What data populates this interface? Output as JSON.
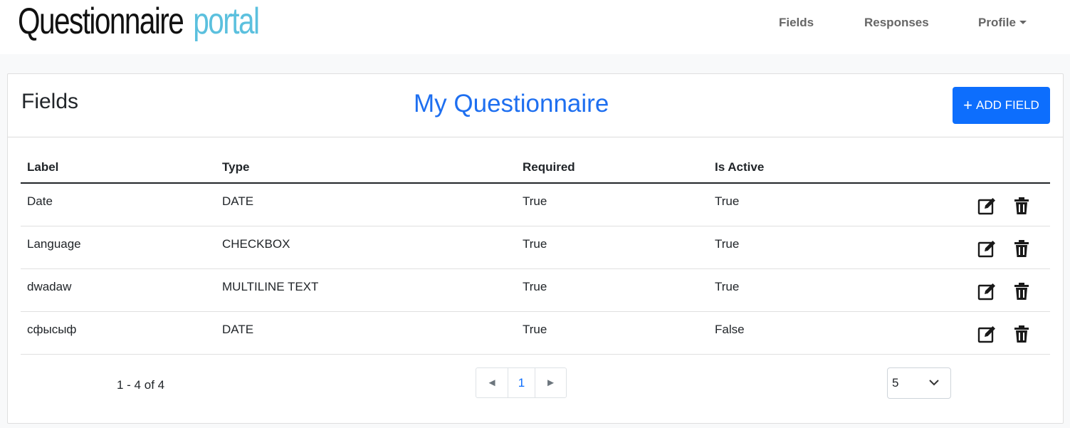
{
  "navbar": {
    "brand_main": "Questionnaire",
    "brand_accent": "portal",
    "links": [
      "Fields",
      "Responses",
      "Profile"
    ]
  },
  "card": {
    "title": "Fields",
    "questionnaire_title": "My Questionnaire",
    "add_button_label": "ADD FIELD"
  },
  "table": {
    "headers": [
      "Label",
      "Type",
      "Required",
      "Is Active"
    ],
    "rows": [
      [
        "Date",
        "DATE",
        "True",
        "True"
      ],
      [
        "Language",
        "CHECKBOX",
        "True",
        "True"
      ],
      [
        "dwadaw",
        "MULTILINE TEXT",
        "True",
        "True"
      ],
      [
        "сфысыф",
        "DATE",
        "True",
        "False"
      ]
    ]
  },
  "pagination": {
    "range_text": "1 - 4 of 4",
    "current_page": "1",
    "page_size": "5"
  },
  "icons": {
    "edit": "edit-icon",
    "delete": "trash-icon",
    "prev": "prev-arrow-icon",
    "next": "next-arrow-icon"
  },
  "colors": {
    "primary": "#0d6efd",
    "brand_accent": "#5bc0de",
    "title_blue": "#1e6ff0"
  }
}
